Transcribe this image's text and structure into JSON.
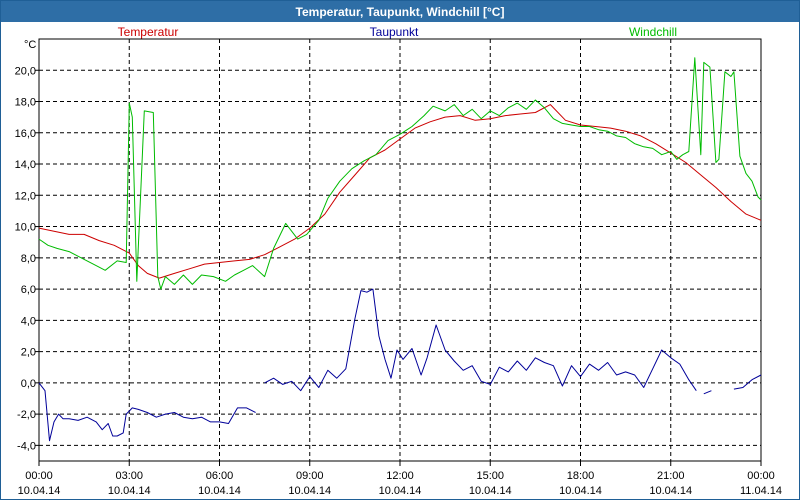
{
  "window": {
    "title": "Temperatur, Taupunkt, Windchill [°C]"
  },
  "chart_data": {
    "type": "line",
    "ylabel": "°C",
    "ylim": [
      -5,
      22
    ],
    "xlim": [
      0,
      24
    ],
    "grid": true,
    "legend_position": "top",
    "yticks": [
      -4,
      -2,
      0,
      2,
      4,
      6,
      8,
      10,
      12,
      14,
      16,
      18,
      20
    ],
    "ytick_labels": [
      "-4,0",
      "-2,0",
      "0,0",
      "2,0",
      "4,0",
      "6,0",
      "8,0",
      "10,0",
      "12,0",
      "14,0",
      "16,0",
      "18,0",
      "20,0"
    ],
    "xticks": [
      0,
      3,
      6,
      9,
      12,
      15,
      18,
      21,
      24
    ],
    "xtick_labels": [
      {
        "time": "00:00",
        "date": "10.04.14"
      },
      {
        "time": "03:00",
        "date": "10.04.14"
      },
      {
        "time": "06:00",
        "date": "10.04.14"
      },
      {
        "time": "09:00",
        "date": "10.04.14"
      },
      {
        "time": "12:00",
        "date": "10.04.14"
      },
      {
        "time": "15:00",
        "date": "10.04.14"
      },
      {
        "time": "18:00",
        "date": "10.04.14"
      },
      {
        "time": "21:00",
        "date": "10.04.14"
      },
      {
        "time": "00:00",
        "date": "11.04.14"
      }
    ],
    "series": [
      {
        "name": "Temperatur",
        "color": "#cc0000",
        "x": [
          0,
          0.5,
          1,
          1.5,
          2,
          2.5,
          3,
          3.3,
          3.6,
          4,
          4.5,
          5,
          5.5,
          6,
          6.5,
          7,
          7.5,
          8,
          8.5,
          9,
          9.5,
          10,
          10.5,
          11,
          11.5,
          12,
          12.5,
          13,
          13.5,
          14,
          14.5,
          15,
          15.5,
          16,
          16.5,
          17,
          17.5,
          18,
          18.5,
          19,
          19.5,
          20,
          20.5,
          21,
          21.5,
          22,
          22.5,
          23,
          23.5,
          24
        ],
        "values": [
          9.9,
          9.7,
          9.5,
          9.5,
          9.1,
          8.8,
          8.3,
          7.5,
          7,
          6.7,
          7,
          7.3,
          7.6,
          7.7,
          7.8,
          7.9,
          8.2,
          8.7,
          9.2,
          9.9,
          10.8,
          12.2,
          13.3,
          14.4,
          14.9,
          15.6,
          16.3,
          16.7,
          17,
          17.1,
          16.8,
          16.9,
          17.1,
          17.2,
          17.3,
          17.8,
          16.8,
          16.5,
          16.4,
          16.3,
          16.1,
          15.8,
          15.3,
          14.7,
          14.1,
          13.3,
          12.5,
          11.6,
          10.8,
          10.4
        ]
      },
      {
        "name": "Taupunkt",
        "color": "#000099",
        "segments": [
          {
            "x": [
              0,
              0.2,
              0.35,
              0.5,
              0.65,
              0.8,
              1,
              1.3,
              1.6,
              1.9,
              2.1,
              2.3,
              2.45,
              2.6,
              2.8,
              2.9,
              3.0,
              3.1,
              3.3,
              3.6,
              3.9,
              4.2,
              4.5,
              4.8,
              5.1,
              5.4,
              5.7,
              6.0,
              6.3,
              6.6,
              6.9,
              7.2
            ],
            "values": [
              0,
              -0.5,
              -3.7,
              -2.5,
              -2,
              -2.3,
              -2.3,
              -2.4,
              -2.2,
              -2.5,
              -3,
              -2.6,
              -3.4,
              -3.4,
              -3.2,
              -2,
              -1.8,
              -1.6,
              -1.7,
              -1.9,
              -2.2,
              -2,
              -1.9,
              -2.2,
              -2.3,
              -2.2,
              -2.5,
              -2.5,
              -2.6,
              -1.6,
              -1.6,
              -1.9
            ]
          },
          {
            "x": [
              7.5,
              7.8,
              8.1,
              8.4,
              8.7,
              9,
              9.3,
              9.6,
              9.9,
              10.2,
              10.5,
              10.7,
              10.9,
              11.1,
              11.3,
              11.5,
              11.7,
              11.9,
              12.1,
              12.4,
              12.7,
              12.9,
              13.2,
              13.5,
              13.8,
              14.1,
              14.4,
              14.7,
              15,
              15.3,
              15.6,
              15.9,
              16.2,
              16.5,
              16.8,
              17.1,
              17.4,
              17.7,
              18,
              18.3,
              18.6,
              18.9,
              19.2,
              19.5,
              19.8,
              20.1,
              20.4,
              20.7,
              21,
              21.3,
              21.6,
              21.85
            ],
            "values": [
              0,
              0.3,
              -0.1,
              0.1,
              -0.5,
              0.4,
              -0.3,
              0.8,
              0.3,
              0.9,
              4.1,
              5.9,
              5.8,
              6,
              3,
              1.5,
              0.3,
              2.1,
              1.5,
              2.2,
              0.5,
              1.6,
              3.7,
              2.1,
              1.4,
              0.8,
              1.1,
              0.1,
              -0.1,
              1,
              0.7,
              1.4,
              0.8,
              1.6,
              1.3,
              1.1,
              -0.2,
              1.1,
              0.4,
              1.2,
              0.8,
              1.3,
              0.5,
              0.7,
              0.5,
              -0.3,
              0.9,
              2.1,
              1.6,
              1.2,
              0.2,
              -0.5
            ]
          },
          {
            "x": [
              22.1,
              22.35
            ],
            "values": [
              -0.7,
              -0.5
            ]
          },
          {
            "x": [
              23.1,
              23.4,
              23.7,
              24
            ],
            "values": [
              -0.4,
              -0.3,
              0.2,
              0.5
            ]
          }
        ]
      },
      {
        "name": "Windchill",
        "color": "#00bb00",
        "x": [
          0,
          0.3,
          0.6,
          1,
          1.4,
          1.8,
          2.2,
          2.6,
          2.9,
          3.0,
          3.1,
          3.25,
          3.5,
          3.8,
          3.95,
          4.05,
          4.2,
          4.5,
          4.8,
          5.1,
          5.4,
          5.8,
          6.2,
          6.5,
          6.8,
          7.1,
          7.5,
          7.8,
          8.2,
          8.6,
          8.9,
          9.3,
          9.6,
          10,
          10.4,
          10.8,
          11.2,
          11.6,
          12,
          12.4,
          12.8,
          13.1,
          13.5,
          13.8,
          14.1,
          14.4,
          14.7,
          15,
          15.3,
          15.6,
          15.9,
          16.2,
          16.5,
          16.8,
          17.1,
          17.4,
          17.7,
          18,
          18.3,
          18.6,
          18.9,
          19.2,
          19.5,
          19.8,
          20.1,
          20.4,
          20.7,
          21,
          21.2,
          21.4,
          21.6,
          21.8,
          22.0,
          22.1,
          22.3,
          22.5,
          22.6,
          22.8,
          23.0,
          23.1,
          23.3,
          23.5,
          23.7,
          23.9,
          24
        ],
        "values": [
          9.2,
          8.8,
          8.6,
          8.4,
          8,
          7.6,
          7.2,
          7.8,
          7.7,
          17.9,
          17,
          6.5,
          17.4,
          17.3,
          6.8,
          6,
          6.8,
          6.3,
          6.9,
          6.3,
          6.9,
          6.8,
          6.5,
          6.9,
          7.2,
          7.5,
          6.8,
          8.6,
          10.2,
          9.2,
          9.5,
          10.4,
          11.8,
          12.9,
          13.7,
          14.2,
          14.6,
          15.5,
          15.9,
          16.4,
          17.1,
          17.7,
          17.4,
          17.8,
          17.1,
          17.5,
          16.9,
          17.4,
          17.1,
          17.6,
          17.9,
          17.5,
          18.1,
          17.6,
          16.9,
          16.6,
          16.5,
          16.4,
          16.4,
          16.2,
          16.1,
          15.8,
          15.7,
          15.3,
          15.1,
          15,
          14.6,
          14.8,
          14.3,
          14.6,
          14.8,
          20.8,
          14.6,
          20.5,
          20.2,
          14.1,
          14.3,
          19.9,
          19.6,
          19.9,
          14.5,
          13.4,
          12.9,
          11.9,
          11.7
        ]
      }
    ]
  }
}
